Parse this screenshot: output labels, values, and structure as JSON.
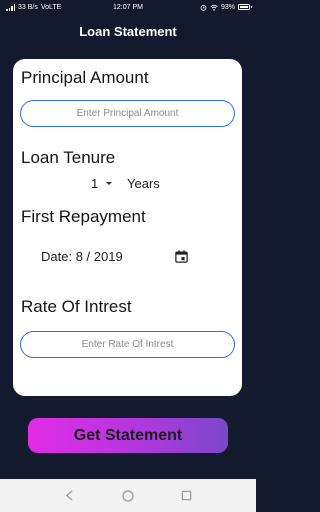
{
  "status_bar": {
    "left": "33 B/s",
    "network": "VoLTE",
    "time": "12:07 PM",
    "battery": "93%"
  },
  "header": {
    "title": "Loan Statement"
  },
  "form": {
    "principal": {
      "label": "Principal Amount",
      "placeholder": "Enter Principal Amount",
      "value": ""
    },
    "tenure": {
      "label": "Loan Tenure",
      "selected": "1",
      "unit": "Years"
    },
    "first_repayment": {
      "label": "First Repayment",
      "date_prefix": "Date:",
      "date_value": "8 / 2019"
    },
    "rate": {
      "label": "Rate Of Intrest",
      "placeholder": "Enter Rate Of Intrest",
      "value": ""
    }
  },
  "actions": {
    "submit_label": "Get Statement"
  },
  "nav_bar": {
    "icons": [
      "back-icon",
      "home-icon",
      "recents-icon"
    ]
  },
  "colors": {
    "background": "#141a2e",
    "card": "#ffffff",
    "input_border": "#2f6fd8",
    "button_gradient_start": "#e12ce6",
    "button_gradient_end": "#7a48c9"
  }
}
